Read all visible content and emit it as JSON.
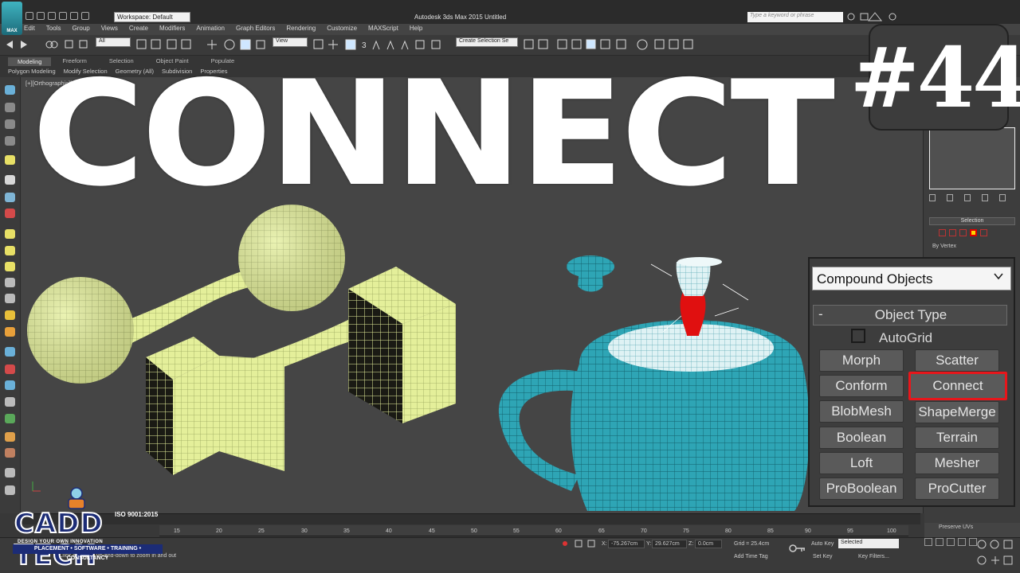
{
  "app": {
    "logo_text": "MAX",
    "window_title": "Autodesk 3ds Max  2015     Untitled",
    "workspace": "Workspace: Default",
    "search_placeholder": "Type a keyword or phrase"
  },
  "menu": [
    "Edit",
    "Tools",
    "Group",
    "Views",
    "Create",
    "Modifiers",
    "Animation",
    "Graph Editors",
    "Rendering",
    "Customize",
    "MAXScript",
    "Help"
  ],
  "toolbar": {
    "filter": "All",
    "ref_coord": "View",
    "named_selection": "Create Selection Se"
  },
  "ribbon": {
    "tabs": [
      "Modeling",
      "Freeform",
      "Selection",
      "Object Paint",
      "Populate"
    ],
    "sub": [
      "Polygon Modeling",
      "Modify Selection",
      "Geometry (All)",
      "Subdivision",
      "Properties"
    ]
  },
  "viewport": {
    "label": "[+][Orthographic][Realistic]"
  },
  "overlay": {
    "title": "CONNECT",
    "episode": "#44"
  },
  "command_panel": {
    "selection_title": "Selection",
    "by_vertex": "By Vertex"
  },
  "compound": {
    "dropdown": "Compound Objects",
    "rollout_minus": "-",
    "rollout_title": "Object Type",
    "autogrid": "AutoGrid",
    "buttons": [
      {
        "label": "Morph"
      },
      {
        "label": "Scatter"
      },
      {
        "label": "Conform"
      },
      {
        "label": "Connect"
      },
      {
        "label": "BlobMesh"
      },
      {
        "label": "ShapeMerge"
      },
      {
        "label": "Boolean"
      },
      {
        "label": "Terrain"
      },
      {
        "label": "Loft"
      },
      {
        "label": "Mesher"
      },
      {
        "label": "ProBoolean"
      },
      {
        "label": "ProCutter"
      }
    ],
    "highlight_color": "#e8161b"
  },
  "timeline": {
    "ticks": [
      "15",
      "20",
      "25",
      "30",
      "35",
      "40",
      "45",
      "50",
      "55",
      "60",
      "65",
      "70",
      "75",
      "80",
      "85",
      "90",
      "95",
      "100"
    ],
    "preserve_uvs": "Preserve UVs"
  },
  "status": {
    "prompt": "Click and drag up-and-down to zoom in and out",
    "x_label": "X:",
    "x_value": "-75.267cm",
    "y_label": "Y:",
    "y_value": "29.627cm",
    "z_label": "Z:",
    "z_value": "0.0cm",
    "grid": "Grid = 25.4cm",
    "add_time_tag": "Add Time Tag",
    "auto_key": "Auto Key",
    "set_key": "Set Key",
    "selected": "Selected",
    "key_filters": "Key Filters..."
  },
  "logo": {
    "name": "CADD TECH",
    "iso": "ISO 9001:2015",
    "tagline": "DESIGN YOUR OWN INNOVATION",
    "strip": "PLACEMENT • SOFTWARE • TRAINING • CONSULTANCY"
  },
  "colors": {
    "mesh_yellow": "#e4ef9a",
    "teapot": "#2ea5b5",
    "knob_red": "#e01010",
    "viewport_bg": "#454545"
  }
}
